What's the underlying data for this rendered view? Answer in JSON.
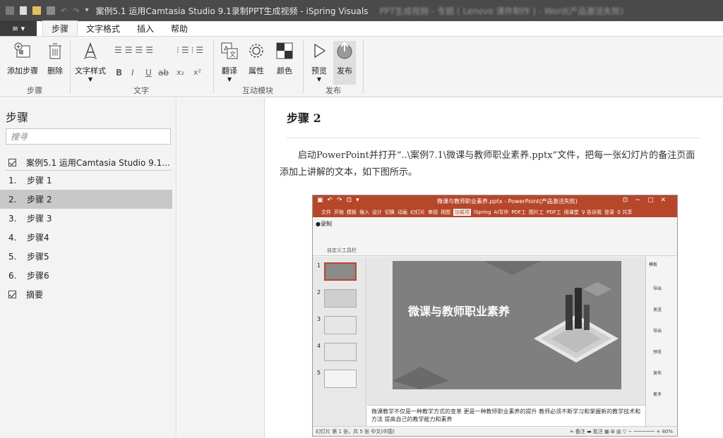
{
  "titlebar": {
    "title": "案例5.1 运用Camtasia Studio 9.1录制PPT生成视频 - iSpring Visuals",
    "title_suffix_blurred": "PPT生成视频 - 专题 ( Lenovo 课件制作 ) - Word(产品激活失败)"
  },
  "tabs": {
    "file_label": "≡ ▾",
    "items": [
      "步骤",
      "文字格式",
      "插入",
      "帮助"
    ],
    "active": "步骤"
  },
  "ribbon": {
    "steps_group": {
      "label": "步骤",
      "add": "添加步骤",
      "delete": "删除"
    },
    "text_group": {
      "label": "文字",
      "style": "文字样式",
      "bold": "B",
      "italic": "I",
      "underline": "U",
      "strike": "ab",
      "sub": "x₂",
      "sup": "x²"
    },
    "interactive_group": {
      "label": "互动模块",
      "translate": "翻译",
      "properties": "属性",
      "color": "颜色"
    },
    "publish_group": {
      "label": "发布",
      "preview": "预览",
      "publish": "发布"
    }
  },
  "left_panel": {
    "title": "步骤",
    "search_placeholder": "搜寻",
    "project": "案例5.1 运用Camtasia Studio 9.1...",
    "steps": [
      {
        "num": "1.",
        "label": "步骤 1"
      },
      {
        "num": "2.",
        "label": "步骤 2"
      },
      {
        "num": "3.",
        "label": "步骤 3"
      },
      {
        "num": "4.",
        "label": "步骤4"
      },
      {
        "num": "5.",
        "label": "步骤5"
      },
      {
        "num": "6.",
        "label": "步骤6"
      }
    ],
    "selected_index": 1,
    "summary": "摘要"
  },
  "content": {
    "title": "步骤 2",
    "paragraph": "启动PowerPoint并打开“..\\案例7.1\\微课与教师职业素养.pptx”文件，把每一张幻灯片的备注页面添加上讲解的文本，如下图所示。"
  },
  "screenshot": {
    "window_title": "微课与教师职业素养.pptx - PowerPoint(产品激活失败)",
    "menu": [
      "文件",
      "开始",
      "模板",
      "插入",
      "设计",
      "切换",
      "动画",
      "幻灯片",
      "审阅",
      "视图",
      "加载项",
      "iSpring",
      "AI写作",
      "PDF工",
      "图片工",
      "PDF工",
      "雨课堂",
      "♀ 告诉我",
      "登录",
      "♀ 共享"
    ],
    "active_menu": "加载项",
    "toolbar_label": "●录制",
    "group_label": "自定义工具栏",
    "thumb_numbers": [
      "1",
      "2",
      "3",
      "4",
      "5"
    ],
    "slide_title": "微课与教师职业素养",
    "notes": "微课教学不仅是一种教学方式的变革 更是一种教师职业素养的提升 教师必须不断学习和掌握新的教学技术和方法 提高自己的教学能力和素养",
    "side_items": [
      "模板",
      "导出",
      "发送",
      "导出",
      "预览",
      "发布",
      "更多"
    ],
    "status_left": "幻灯片 第 1 张，共 5 张   中文(中国)",
    "status_right": "≐ 备注  ▬ 批注   ▦  ⊞  ▥  ▽  − ─────── +  40%"
  }
}
